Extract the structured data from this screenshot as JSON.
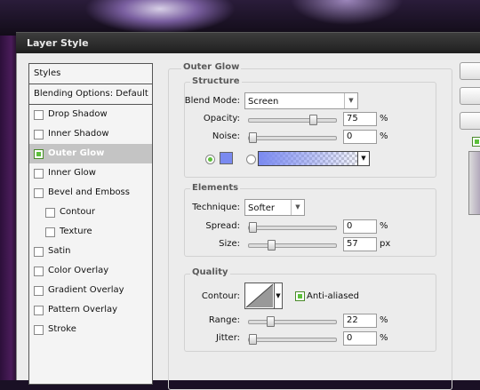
{
  "window": {
    "title": "Layer Style"
  },
  "styles_list": {
    "header": "Styles",
    "blending_options": "Blending Options: Default",
    "items": [
      {
        "label": "Drop Shadow",
        "checked": false,
        "selected": false,
        "indent": false
      },
      {
        "label": "Inner Shadow",
        "checked": false,
        "selected": false,
        "indent": false
      },
      {
        "label": "Outer Glow",
        "checked": true,
        "selected": true,
        "indent": false
      },
      {
        "label": "Inner Glow",
        "checked": false,
        "selected": false,
        "indent": false
      },
      {
        "label": "Bevel and Emboss",
        "checked": false,
        "selected": false,
        "indent": false
      },
      {
        "label": "Contour",
        "checked": false,
        "selected": false,
        "indent": true
      },
      {
        "label": "Texture",
        "checked": false,
        "selected": false,
        "indent": true
      },
      {
        "label": "Satin",
        "checked": false,
        "selected": false,
        "indent": false
      },
      {
        "label": "Color Overlay",
        "checked": false,
        "selected": false,
        "indent": false
      },
      {
        "label": "Gradient Overlay",
        "checked": false,
        "selected": false,
        "indent": false
      },
      {
        "label": "Pattern Overlay",
        "checked": false,
        "selected": false,
        "indent": false
      },
      {
        "label": "Stroke",
        "checked": false,
        "selected": false,
        "indent": false
      }
    ]
  },
  "outer_glow": {
    "title": "Outer Glow",
    "structure": {
      "title": "Structure",
      "blend_mode_label": "Blend Mode:",
      "blend_mode_value": "Screen",
      "opacity_label": "Opacity:",
      "opacity_value": "75",
      "opacity_level": 0.75,
      "opacity_unit": "%",
      "noise_label": "Noise:",
      "noise_value": "0",
      "noise_level": 0,
      "noise_unit": "%",
      "glow_color": "#7a8af0"
    },
    "elements": {
      "title": "Elements",
      "technique_label": "Technique:",
      "technique_value": "Softer",
      "spread_label": "Spread:",
      "spread_value": "0",
      "spread_level": 0,
      "spread_unit": "%",
      "size_label": "Size:",
      "size_value": "57",
      "size_level": 0.23,
      "size_unit": "px"
    },
    "quality": {
      "title": "Quality",
      "contour_label": "Contour:",
      "anti_aliased_label": "Anti-aliased",
      "anti_aliased_checked": true,
      "range_label": "Range:",
      "range_value": "22",
      "range_level": 0.22,
      "range_unit": "%",
      "jitter_label": "Jitter:",
      "jitter_value": "0",
      "jitter_level": 0,
      "jitter_unit": "%"
    }
  },
  "icons": {
    "dropdown": "chevron-down-icon",
    "checkbox_on": "check-icon"
  }
}
